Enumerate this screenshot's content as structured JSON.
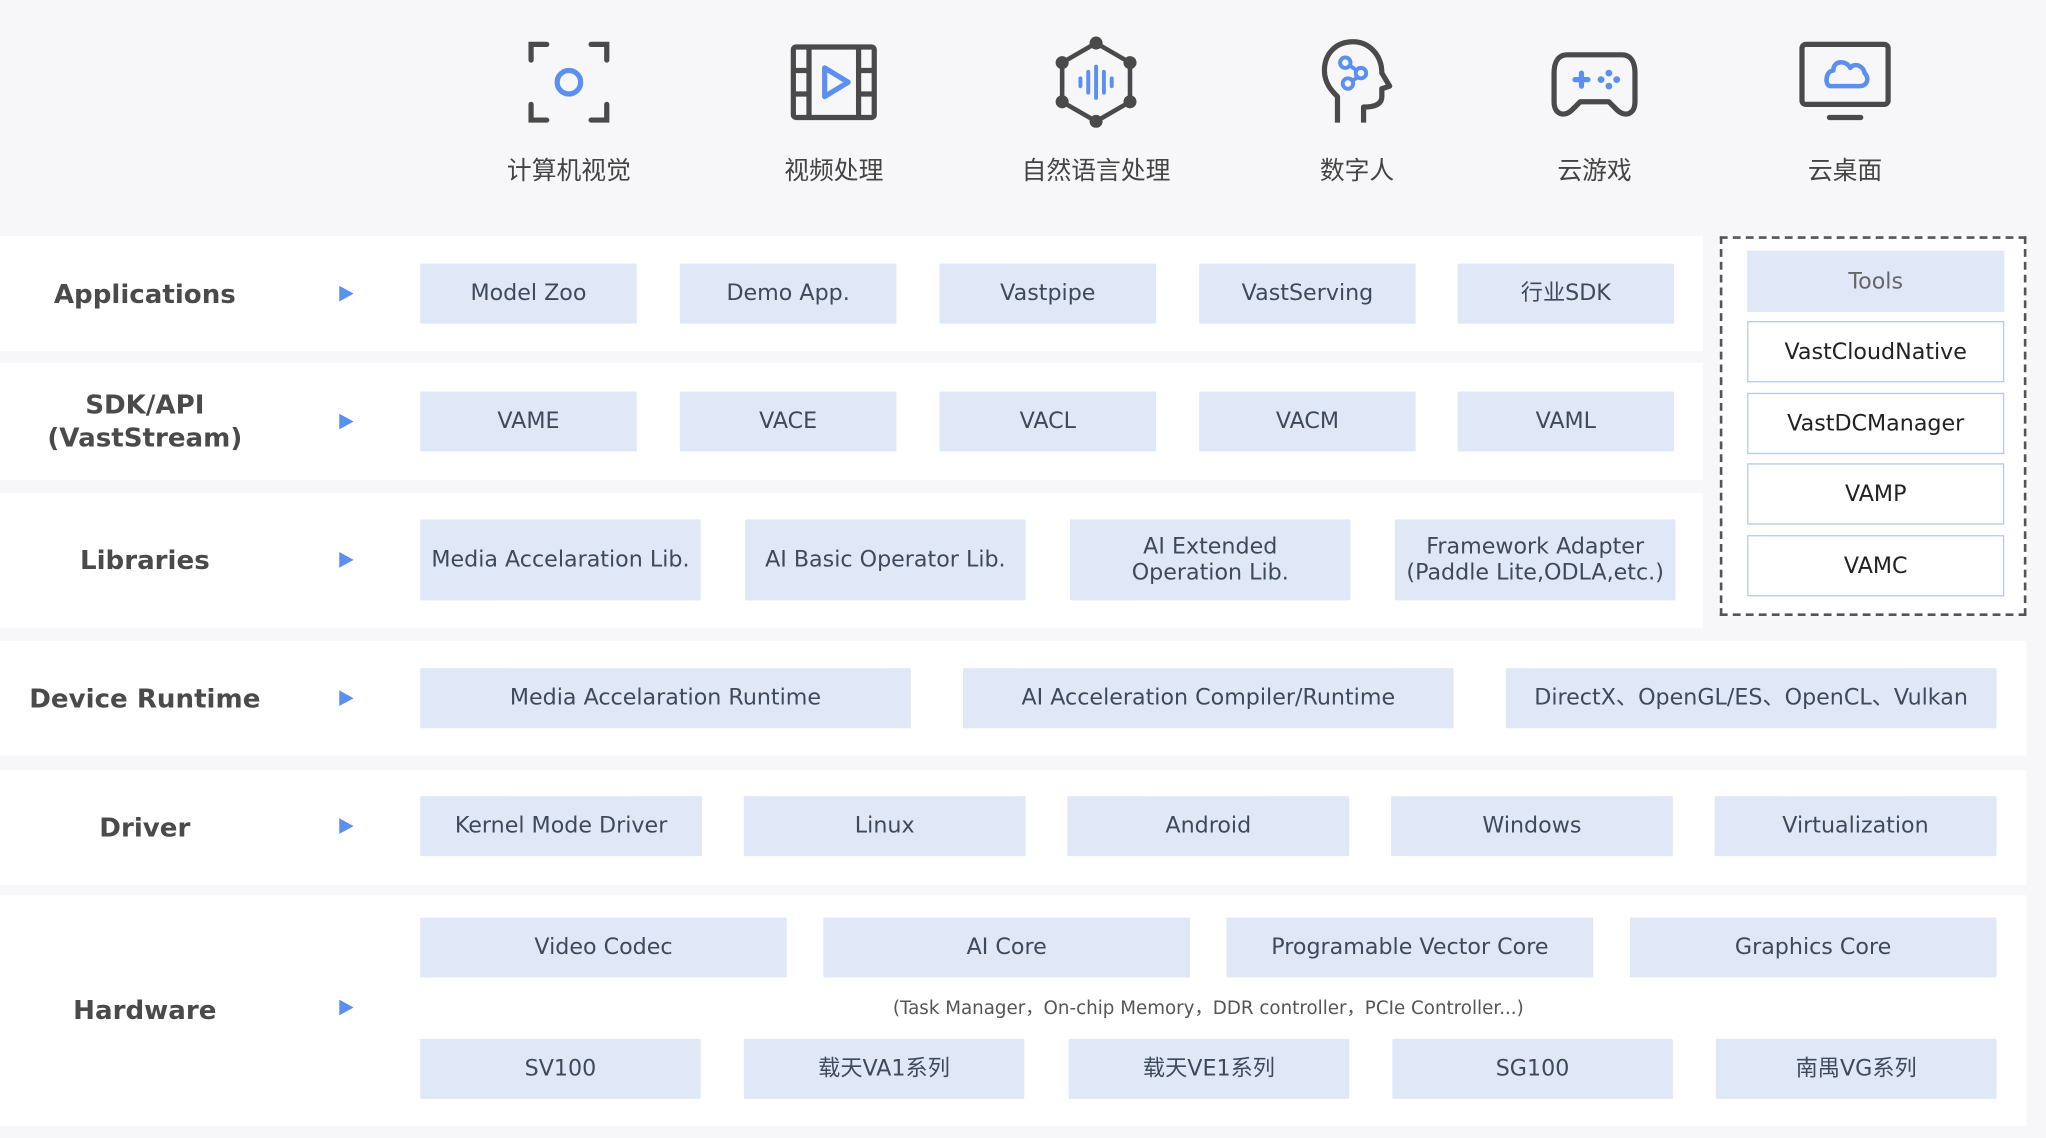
{
  "apps": [
    {
      "icon": "computer-vision-icon",
      "label": "计算机视觉"
    },
    {
      "icon": "video-processing-icon",
      "label": "视频处理"
    },
    {
      "icon": "nlp-icon",
      "label": "自然语言处理"
    },
    {
      "icon": "digital-human-icon",
      "label": "数字人"
    },
    {
      "icon": "cloud-gaming-icon",
      "label": "云游戏"
    },
    {
      "icon": "cloud-desktop-icon",
      "label": "云桌面"
    }
  ],
  "rows": {
    "applications": {
      "label": "Applications",
      "items": [
        "Model Zoo",
        "Demo App.",
        "Vastpipe",
        "VastServing",
        "行业SDK"
      ]
    },
    "sdk": {
      "label": "SDK/API\n(VastStream)",
      "items": [
        "VAME",
        "VACE",
        "VACL",
        "VACM",
        "VAML"
      ]
    },
    "libraries": {
      "label": "Libraries",
      "items": [
        "Media Accelaration Lib.",
        "AI Basic Operator Lib.",
        "AI Extended\nOperation Lib.",
        "Framework Adapter\n(Paddle Lite,ODLA,etc.)"
      ]
    },
    "runtime": {
      "label": "Device Runtime",
      "items": [
        "Media Accelaration Runtime",
        "AI Acceleration Compiler/Runtime",
        "DirectX、OpenGL/ES、OpenCL、Vulkan"
      ]
    },
    "driver": {
      "label": "Driver",
      "items": [
        "Kernel Mode Driver",
        "Linux",
        "Android",
        "Windows",
        "Virtualization"
      ]
    },
    "hardware": {
      "label": "Hardware",
      "cores": [
        "Video Codec",
        "AI Core",
        "Programable Vector Core",
        "Graphics Core"
      ],
      "note": "(Task Manager，On-chip Memory，DDR controller，PCIe Controller...)",
      "chips": [
        "SV100",
        "载天VA1系列",
        "载天VE1系列",
        "SG100",
        "南禺VG系列"
      ]
    }
  },
  "tools": {
    "title": "Tools",
    "items": [
      "VastCloudNative",
      "VastDCManager",
      "VAMP",
      "VAMC"
    ]
  },
  "colors": {
    "box_fill": "#e0e8f8",
    "accent": "#5b8ff0",
    "icon_gray": "#4a4a4a"
  }
}
